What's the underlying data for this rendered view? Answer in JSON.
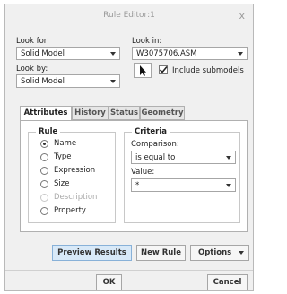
{
  "window": {
    "title": "Rule Editor:1",
    "close_glyph": "x"
  },
  "look_for": {
    "label": "Look for:",
    "value": "Solid Model"
  },
  "look_in": {
    "label": "Look in:",
    "value": "W3075706.ASM"
  },
  "look_by": {
    "label": "Look by:",
    "value": "Solid Model"
  },
  "include_submodels": {
    "label": "Include submodels",
    "checked": true
  },
  "tabs": [
    {
      "label": "Attributes",
      "active": true
    },
    {
      "label": "History",
      "active": false
    },
    {
      "label": "Status",
      "active": false
    },
    {
      "label": "Geometry",
      "active": false
    }
  ],
  "rule": {
    "title": "Rule",
    "options": [
      {
        "label": "Name",
        "selected": true,
        "enabled": true
      },
      {
        "label": "Type",
        "selected": false,
        "enabled": true
      },
      {
        "label": "Expression",
        "selected": false,
        "enabled": true
      },
      {
        "label": "Size",
        "selected": false,
        "enabled": true
      },
      {
        "label": "Description",
        "selected": false,
        "enabled": false
      },
      {
        "label": "Property",
        "selected": false,
        "enabled": true
      }
    ]
  },
  "criteria": {
    "title": "Criteria",
    "comparison_label": "Comparison:",
    "comparison_value": "is equal to",
    "value_label": "Value:",
    "value_value": "*"
  },
  "buttons": {
    "preview": "Preview Results",
    "new_rule": "New Rule",
    "options": "Options",
    "ok": "OK",
    "cancel": "Cancel"
  }
}
